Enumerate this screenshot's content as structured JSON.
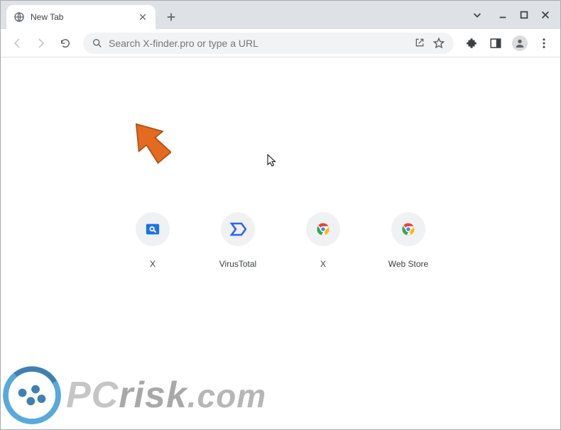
{
  "titlebar": {
    "tab_title": "New Tab",
    "window_controls": {
      "chevron": "⌄",
      "minimize": "—",
      "maximize": "▢",
      "close": "✕"
    }
  },
  "omnibox": {
    "placeholder": "Search X-finder.pro or type a URL"
  },
  "shortcuts": [
    {
      "label": "X",
      "icon": "blue-search"
    },
    {
      "label": "VirusTotal",
      "icon": "virustotal"
    },
    {
      "label": "X",
      "icon": "chrome"
    },
    {
      "label": "Web Store",
      "icon": "chrome"
    }
  ],
  "watermark": {
    "text_pc": "PC",
    "text_risk": "risk",
    "text_com": ".com"
  },
  "colors": {
    "arrow": "#e36a1e",
    "tabstrip": "#dee1e6",
    "omnibox": "#f1f3f4"
  }
}
